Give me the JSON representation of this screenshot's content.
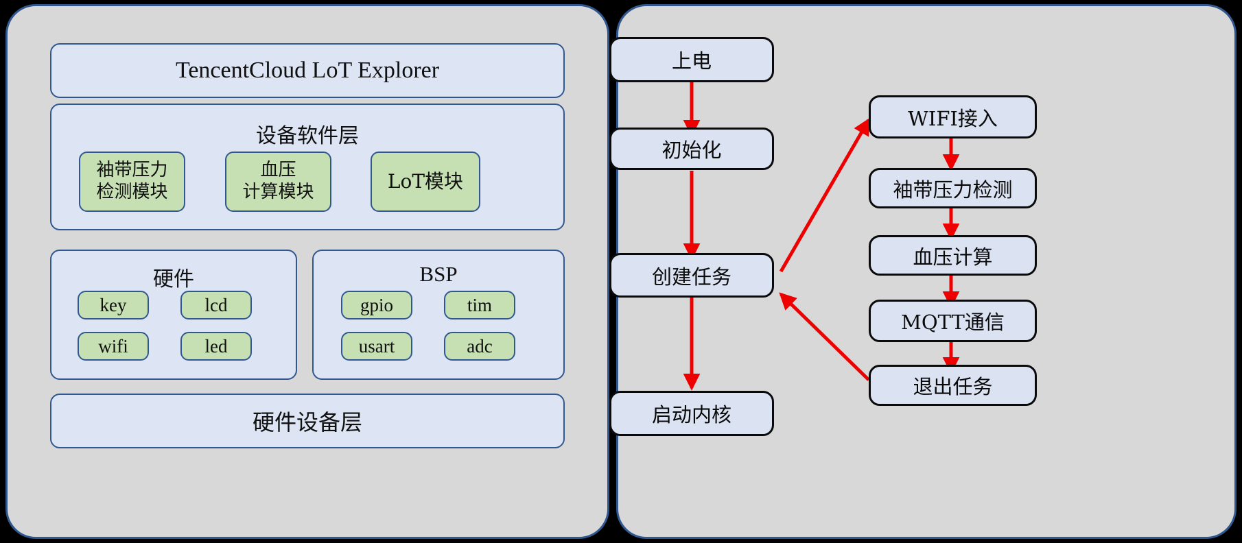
{
  "diagram": {
    "left_panel": {
      "name": "system-architecture",
      "cloud_layer": {
        "label": "TencentCloud LoT Explorer"
      },
      "software_layer": {
        "title": "设备软件层",
        "modules": [
          {
            "label": "袖带压力\n检测模块",
            "line1": "袖带压力",
            "line2": "检测模块"
          },
          {
            "label": "血压\n计算模块",
            "line1": "血压",
            "line2": "计算模块"
          },
          {
            "label": "LoT模块",
            "line1": "LoT模块",
            "line2": ""
          }
        ]
      },
      "hardware_group": {
        "title": "硬件",
        "items": [
          "key",
          "lcd",
          "wifi",
          "led"
        ]
      },
      "bsp_group": {
        "title": "BSP",
        "items": [
          "gpio",
          "tim",
          "usart",
          "adc"
        ]
      },
      "device_layer": {
        "label": "硬件设备层"
      }
    },
    "right_panel": {
      "name": "startup-flowchart",
      "main_chain": [
        {
          "id": "power-on",
          "label": "上电"
        },
        {
          "id": "init",
          "label": "初始化"
        },
        {
          "id": "create-task",
          "label": "创建任务"
        },
        {
          "id": "start-kernel",
          "label": "启动内核"
        }
      ],
      "task_chain": [
        {
          "id": "wifi-connect",
          "label": "WIFI接入"
        },
        {
          "id": "cuff-pressure-detect",
          "label": "袖带压力检测"
        },
        {
          "id": "blood-pressure-calc",
          "label": "血压计算"
        },
        {
          "id": "mqtt-comm",
          "label": "MQTT通信"
        },
        {
          "id": "exit-task",
          "label": "退出任务"
        }
      ],
      "edges": [
        {
          "from": "power-on",
          "to": "init"
        },
        {
          "from": "init",
          "to": "create-task"
        },
        {
          "from": "create-task",
          "to": "start-kernel"
        },
        {
          "from": "create-task",
          "to": "wifi-connect"
        },
        {
          "from": "wifi-connect",
          "to": "cuff-pressure-detect"
        },
        {
          "from": "cuff-pressure-detect",
          "to": "blood-pressure-calc"
        },
        {
          "from": "blood-pressure-calc",
          "to": "mqtt-comm"
        },
        {
          "from": "mqtt-comm",
          "to": "exit-task"
        },
        {
          "from": "exit-task",
          "to": "create-task"
        }
      ]
    }
  },
  "colors": {
    "background": "#000000",
    "panel_fill": "#d8d8d8",
    "panel_border": "#30578f",
    "blue_box_fill": "#dde4f3",
    "blue_box_border": "#30578f",
    "green_box_fill": "#c6e0b3",
    "flow_box_fill": "#dbe2f1",
    "flow_box_border": "#0a0a0a",
    "arrow": "#ee0000"
  }
}
